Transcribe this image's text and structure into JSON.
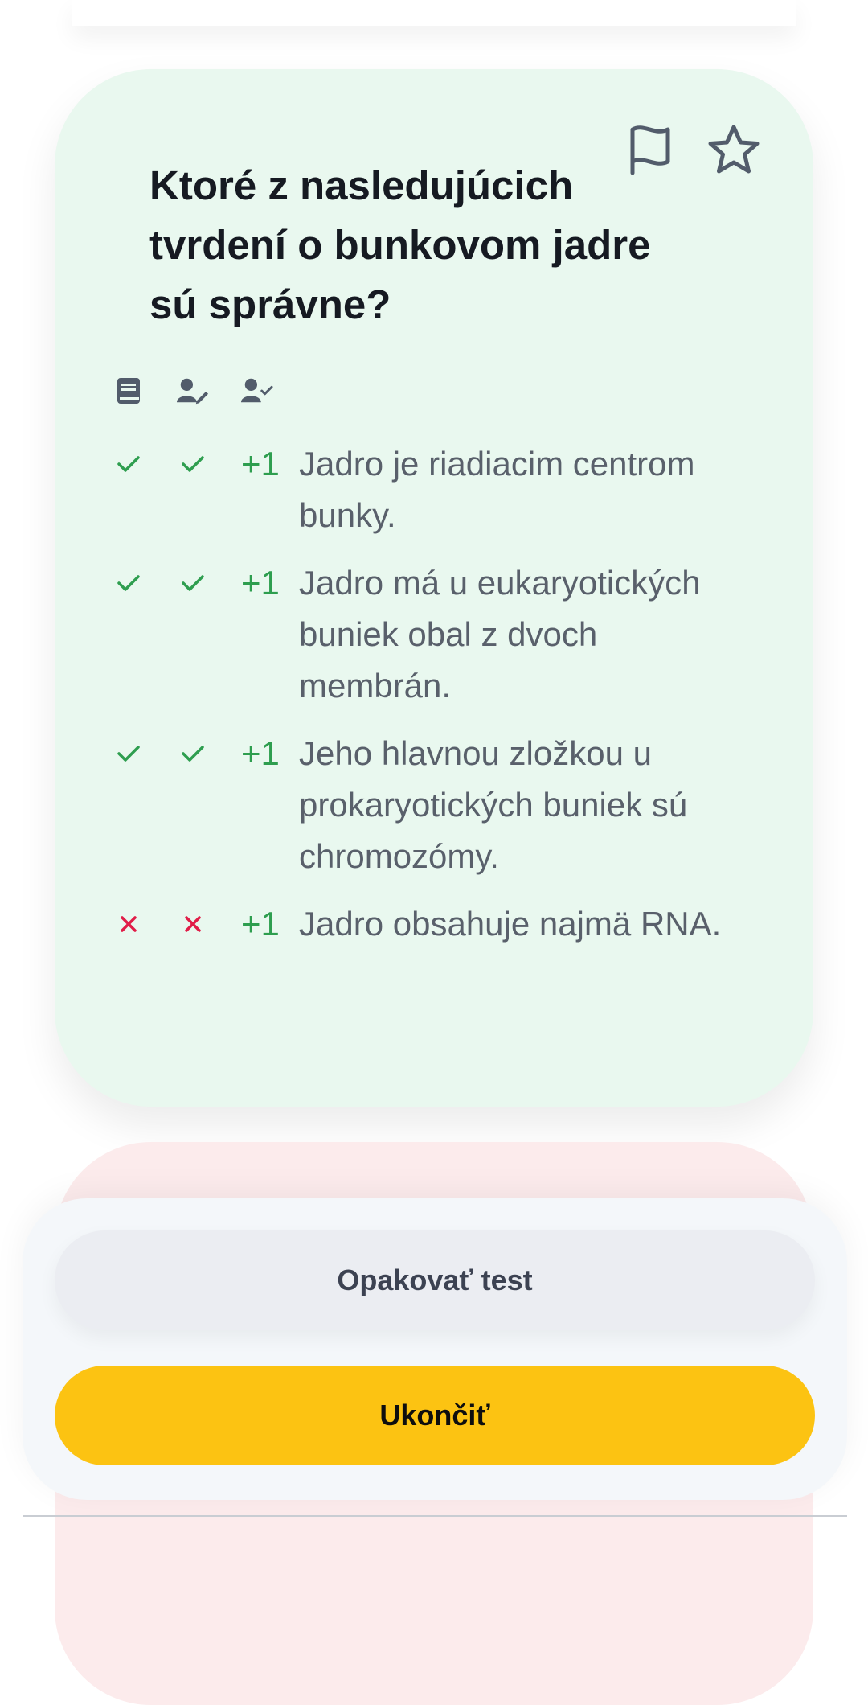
{
  "question": {
    "text": "Ktoré z nasledujúcich tvrdení o bunkovom jadre sú správne?"
  },
  "card_actions": {
    "flag_icon": "flag-icon",
    "star_icon": "star-icon"
  },
  "column_icons": [
    "book-icon",
    "user-edit-icon",
    "user-check-icon"
  ],
  "answers": [
    {
      "text": "Jadro je riadiacim centrom bunky.",
      "correct": "check",
      "user": "check",
      "points": "+1"
    },
    {
      "text": "Jadro má u eukaryotických buniek obal z dvoch membrán.",
      "correct": "check",
      "user": "check",
      "points": "+1"
    },
    {
      "text": "Jeho hlavnou zložkou u prokaryotických buniek sú chromozómy.",
      "correct": "check",
      "user": "check",
      "points": "+1"
    },
    {
      "text": "Jadro obsahuje najmä RNA.",
      "correct": "cross",
      "user": "cross",
      "points": "+1"
    }
  ],
  "buttons": {
    "repeat_label": "Opakovať test",
    "finish_label": "Ukončiť"
  },
  "colors": {
    "card_background": "#e9f8ef",
    "second_card_background": "#fcebec",
    "check": "#2e9e4f",
    "cross": "#e11d48",
    "primary_button": "#fcc312",
    "secondary_button": "#ebedf2"
  }
}
